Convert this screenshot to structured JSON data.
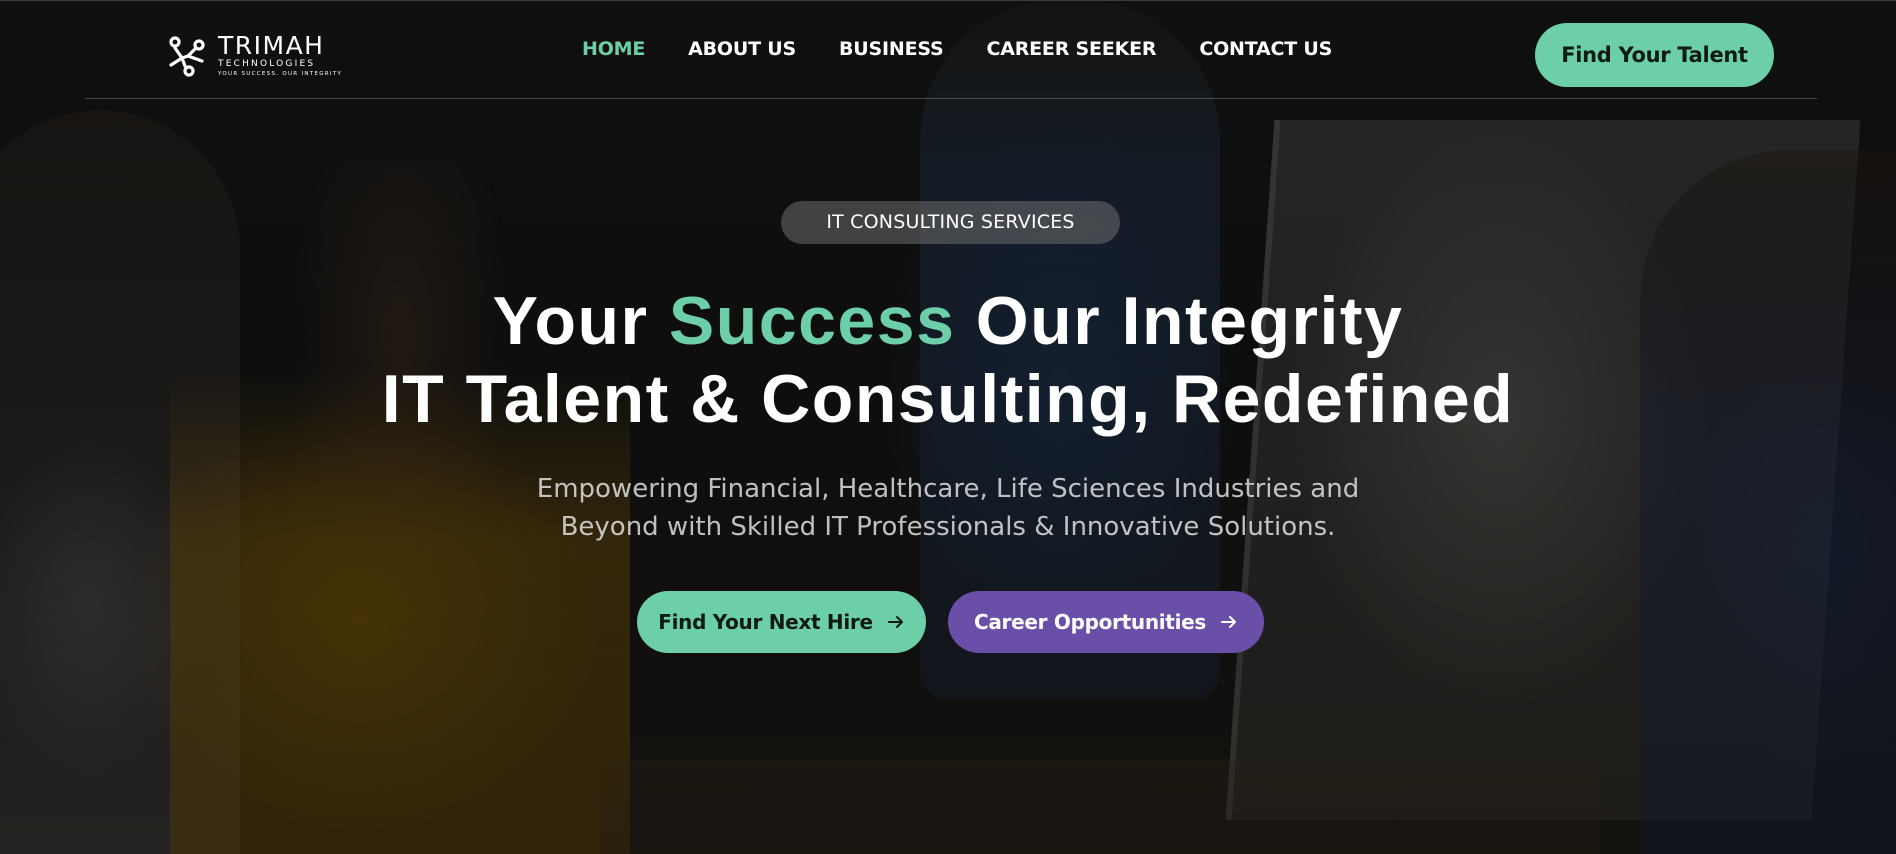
{
  "brand": {
    "name": "TRIMAH",
    "sub": "TECHNOLOGIES",
    "tagline": "YOUR SUCCESS. OUR INTEGRITY"
  },
  "nav": {
    "items": [
      {
        "label": "HOME",
        "active": true
      },
      {
        "label": "ABOUT US",
        "active": false
      },
      {
        "label": "BUSINESS",
        "active": false
      },
      {
        "label": "CAREER SEEKER",
        "active": false
      },
      {
        "label": "CONTACT US",
        "active": false
      }
    ],
    "cta_label": "Find Your Talent"
  },
  "hero": {
    "badge": "IT CONSULTING SERVICES",
    "headline_pre": "Your ",
    "headline_accent": "Success",
    "headline_post": " Our Integrity",
    "headline_line2": "IT Talent & Consulting, Redefined",
    "subtext_line1": "Empowering Financial, Healthcare, Life Sciences Industries and",
    "subtext_line2": "Beyond with Skilled IT Professionals & Innovative Solutions.",
    "primary_button": "Find Your Next Hire",
    "secondary_button": "Career Opportunities"
  },
  "colors": {
    "accent_green": "#6dcfa8",
    "accent_purple": "#6a4fa8"
  },
  "icons": {
    "logo": "trimah-logo-icon",
    "button_arrow": "arrow-right-icon"
  }
}
